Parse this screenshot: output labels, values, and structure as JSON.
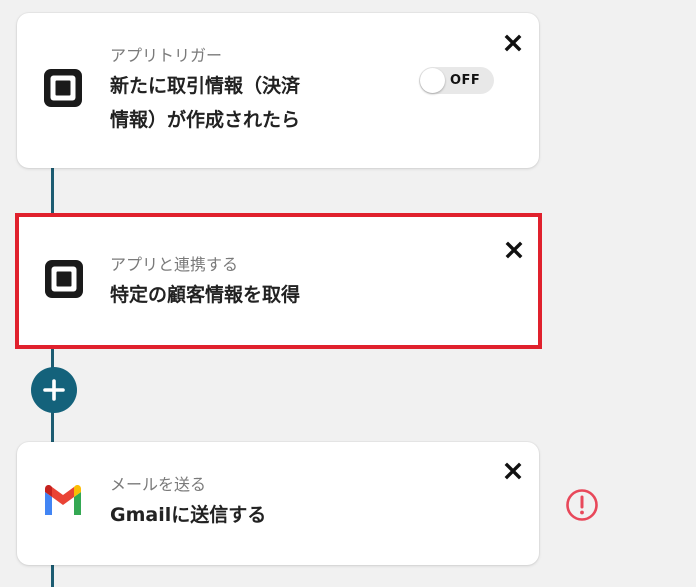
{
  "flow": {
    "steps": [
      {
        "subtitle": "アプリトリガー",
        "title_line1": "新たに取引情報（決済",
        "title_line2": "情報）が作成されたら",
        "app_icon": "square-pos-icon",
        "toggle_label": "OFF",
        "toggle_on": false
      },
      {
        "subtitle": "アプリと連携する",
        "title": "特定の顧客情報を取得",
        "app_icon": "square-pos-icon",
        "selected": true
      },
      {
        "subtitle": "メールを送る",
        "title": "Gmailに送信する",
        "app_icon": "gmail-icon",
        "warning_icon": "exclamation-circle-icon"
      }
    ],
    "add_icon": "plus-icon",
    "close_icon": "close-icon"
  },
  "colors": {
    "line": "#1c5c72",
    "add_button": "#14627b",
    "selected_border": "#e0212d",
    "warning": "#e8485a"
  }
}
